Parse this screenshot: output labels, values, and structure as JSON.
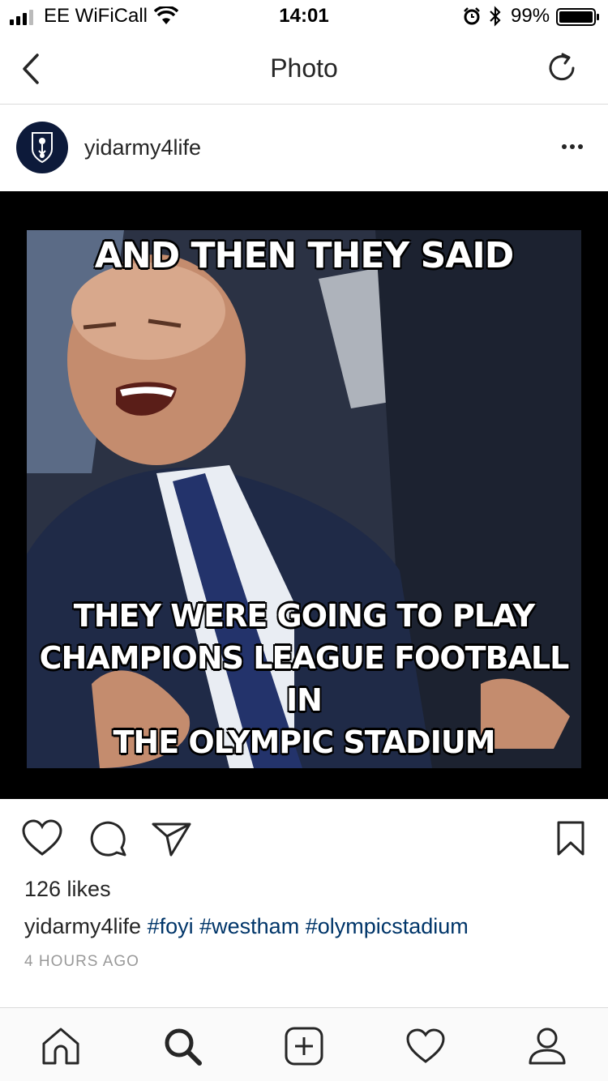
{
  "status_bar": {
    "carrier": "EE WiFiCall",
    "time": "14:01",
    "battery": "99%",
    "icons": [
      "signal-icon",
      "wifi-icon",
      "alarm-icon",
      "bluetooth-icon",
      "battery-icon"
    ]
  },
  "nav": {
    "title": "Photo",
    "icons": [
      "back-icon",
      "refresh-icon"
    ]
  },
  "post": {
    "username": "yidarmy4life",
    "avatar_colors": {
      "background": "#0d1a3a",
      "emblem": "#ffffff"
    },
    "image": {
      "top_text": "AND THEN THEY SAID",
      "bottom_line_1": "THEY WERE GOING TO PLAY",
      "bottom_line_2": "CHAMPIONS LEAGUE FOOTBALL IN",
      "bottom_line_3": "THE OLYMPIC STADIUM"
    },
    "likes": "126 likes",
    "caption_user": "yidarmy4life",
    "hashtags": [
      "#foyi",
      "#westham",
      "#olympicstadium"
    ],
    "time_ago": "4 HOURS AGO",
    "action_icons": [
      "heart-icon",
      "comment-icon",
      "share-icon",
      "bookmark-icon"
    ]
  },
  "tab_bar": {
    "icons": [
      "home-icon",
      "search-icon",
      "add-icon",
      "activity-icon",
      "profile-icon"
    ]
  },
  "colors": {
    "hashtag": "#003569",
    "text": "#262626",
    "muted": "#999999",
    "divider": "#dbdbdb"
  }
}
